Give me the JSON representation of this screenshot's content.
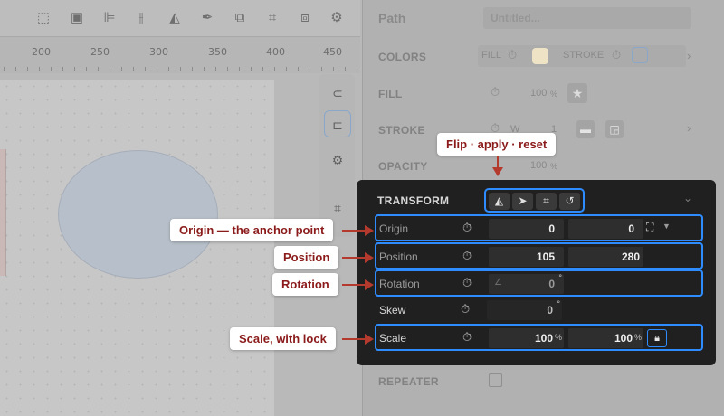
{
  "toolbar": {
    "icons": [
      "select-icon",
      "stack-icon",
      "align-left-icon",
      "align-center-icon",
      "flip-icon",
      "pen-icon",
      "copy-icon",
      "crop-icon",
      "boolean-icon",
      "gear-icon"
    ]
  },
  "ruler": {
    "labels": [
      "200",
      "250",
      "300",
      "350",
      "400",
      "450"
    ]
  },
  "panel": {
    "path_label": "Path",
    "path_name_placeholder": "Untitled...",
    "colors_label": "COLORS",
    "fill_short": "FILL",
    "stroke_short": "STROKE",
    "fill_label": "FILL",
    "fill_opacity": "100",
    "percent": "%",
    "stroke_label": "STROKE",
    "stroke_w": "W",
    "stroke_width": "1",
    "opacity_label": "OPACITY",
    "opacity_value": "100",
    "repeater_label": "REPEATER",
    "fill_color": "#f3e4c0"
  },
  "transform": {
    "title": "TRANSFORM",
    "origin": {
      "label": "Origin",
      "x": "0",
      "y": "0"
    },
    "position": {
      "label": "Position",
      "x": "105",
      "y": "280"
    },
    "rotation": {
      "label": "Rotation",
      "value": "0",
      "unit": "°"
    },
    "skew": {
      "label": "Skew",
      "value": "0",
      "unit": "°"
    },
    "scale": {
      "label": "Scale",
      "x": "100",
      "y": "100",
      "unit": "%"
    }
  },
  "callouts": {
    "flip": "Flip · apply · reset",
    "origin": "Origin — the anchor point",
    "position": "Position",
    "rotation": "Rotation",
    "scale": "Scale, with lock"
  },
  "colors": {
    "accent": "#2f8cff",
    "callout_text": "#8b1a1a",
    "arrow": "#b53a2e",
    "panel_dark": "#202020"
  }
}
